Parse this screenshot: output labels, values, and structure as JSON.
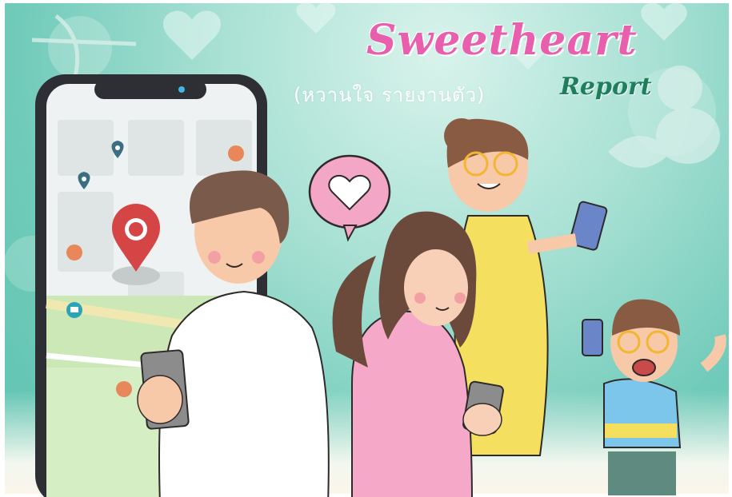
{
  "header": {
    "title": "Sweetheart",
    "subtitle": "(หวานใจ รายงานตัว)",
    "report_label": "Report"
  },
  "colors": {
    "title_pink": "#e85fae",
    "report_green": "#1f7f5d",
    "background_teal": "#6fcab9"
  },
  "illustration": {
    "pins": [
      "location-pin-icon",
      "food-pin-icon",
      "camera-pin-icon"
    ],
    "bubble": "heart-speech-bubble"
  }
}
